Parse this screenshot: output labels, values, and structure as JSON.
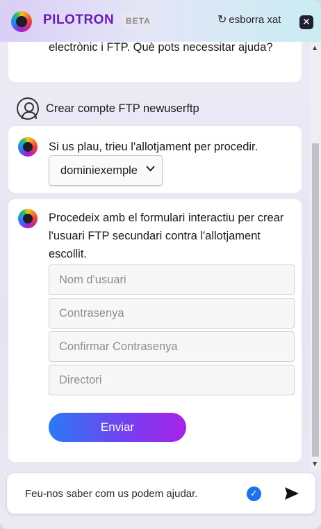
{
  "header": {
    "brand": "PILOTRON",
    "badge": "BETA",
    "clear_label": "esborra xat",
    "clear_icon": "↻",
    "close_icon": "✕"
  },
  "messages": {
    "bot_intro": "electrònic i FTP. Què pots necessitar ajuda?",
    "user_request": "Crear compte FTP newuserftp",
    "bot_choose_hosting": "Si us plau, trieu l'allotjament per procedir.",
    "hosting_select_value": "dominiexemple",
    "bot_form_intro": "Procedeix amb el formulari interactiu per crear l'usuari FTP secundari contra l'allotjament escollit."
  },
  "form": {
    "username_placeholder": "Nom d'usuari",
    "password_placeholder": "Contrasenya",
    "confirm_placeholder": "Confirmar Contrasenya",
    "directory_placeholder": "Directori",
    "submit_label": "Enviar"
  },
  "composer": {
    "placeholder": "Feu-nos saber com us podem ajudar."
  },
  "colors": {
    "brand": "#6a1bb5",
    "accent_blue": "#1a73e8",
    "button_gradient_start": "#2a7af4",
    "button_gradient_end": "#a624e8"
  }
}
